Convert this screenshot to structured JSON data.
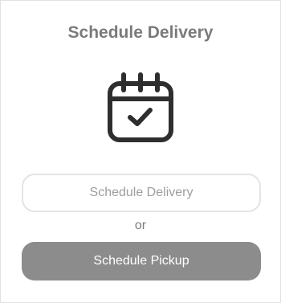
{
  "modal": {
    "title": "Schedule Delivery",
    "icon": "calendar-check-icon",
    "delivery_button_label": "Schedule Delivery",
    "separator_text": "or",
    "pickup_button_label": "Schedule Pickup"
  },
  "colors": {
    "title_text": "#7b7b7b",
    "icon_stroke": "#2e2e2e",
    "outline_button_border": "#e4e4e4",
    "outline_button_text": "#9d9d9d",
    "filled_button_bg": "#8c8c8c",
    "filled_button_text": "#ffffff"
  }
}
